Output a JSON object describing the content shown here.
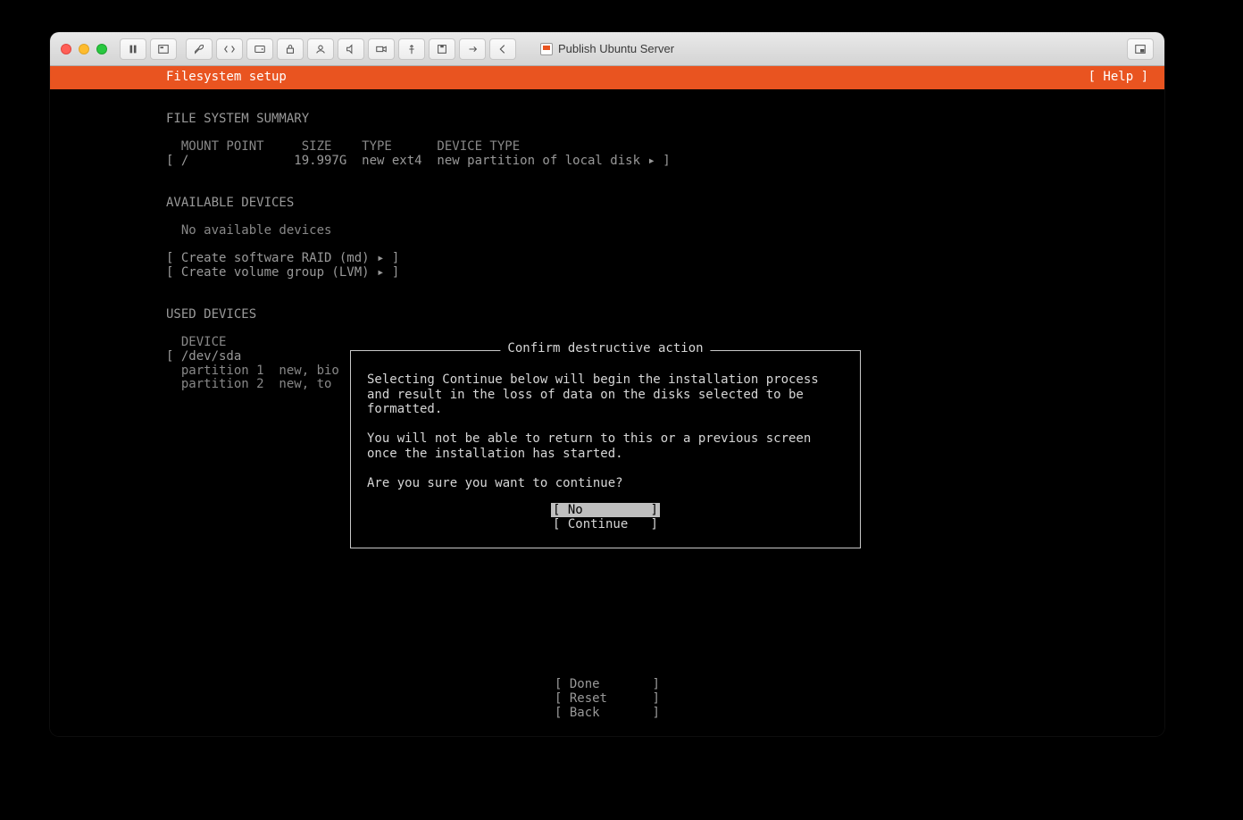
{
  "window_title": "Publish Ubuntu Server",
  "header": {
    "title": "Filesystem setup",
    "help": "[ Help ]"
  },
  "summary": {
    "heading": "FILE SYSTEM SUMMARY",
    "columns": "  MOUNT POINT     SIZE    TYPE      DEVICE TYPE",
    "row": "[ /              19.997G  new ext4  new partition of local disk ▸ ]"
  },
  "available": {
    "heading": "AVAILABLE DEVICES",
    "none": "  No available devices",
    "raid": "[ Create software RAID (md) ▸ ]",
    "lvm": "[ Create volume group (LVM) ▸ ]"
  },
  "used": {
    "heading": "USED DEVICES",
    "device_col": "  DEVICE",
    "dev": "[ /dev/sda",
    "p1": "  partition 1  new, bio",
    "p2": "  partition 2  new, to"
  },
  "dialog": {
    "title": "Confirm destructive action",
    "para1": "Selecting Continue below will begin the installation process and result in the loss of data on the disks selected to be formatted.",
    "para2": "You will not be able to return to this or a previous screen once the installation has started.",
    "para3": "Are you sure you want to continue?",
    "btn_no": "[ No         ]",
    "btn_cont": "[ Continue   ]"
  },
  "footer": {
    "done": "[ Done       ]",
    "reset": "[ Reset      ]",
    "back": "[ Back       ]"
  }
}
